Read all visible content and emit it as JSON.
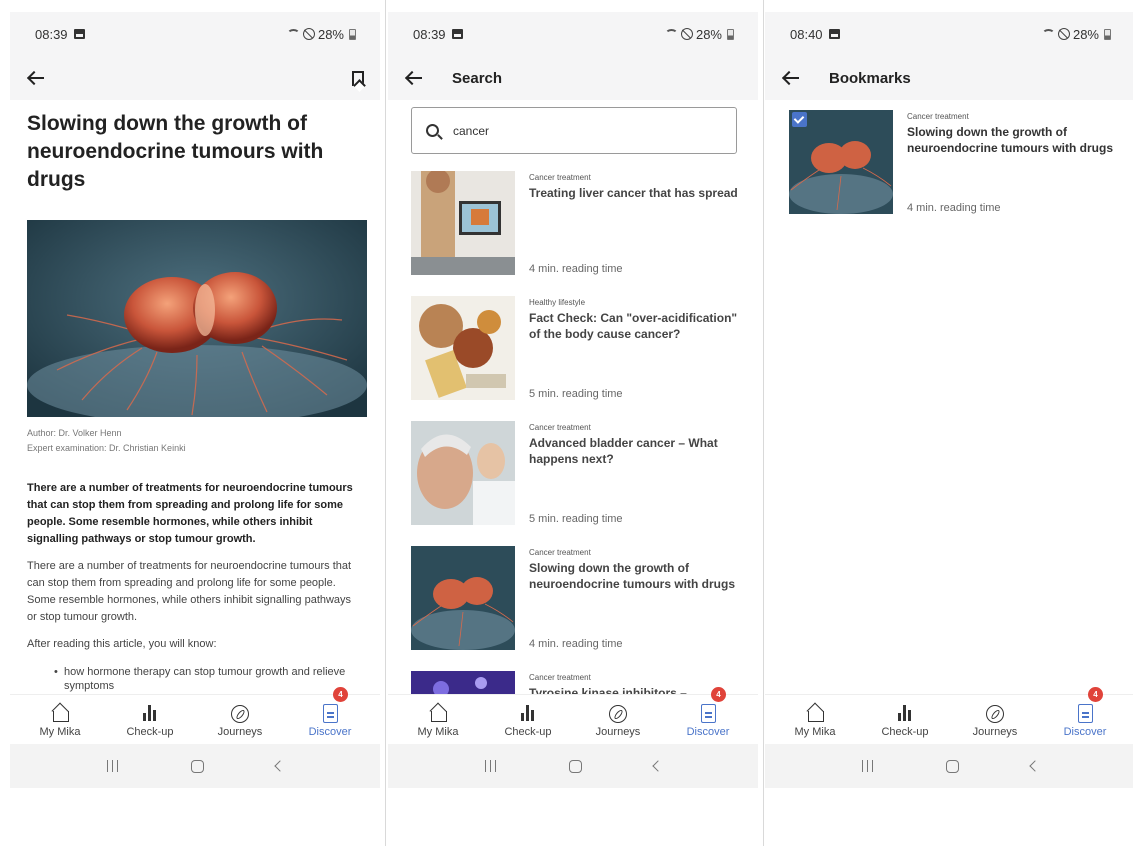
{
  "status_bars": [
    {
      "time": "08:39",
      "battery": "28%"
    },
    {
      "time": "08:39",
      "battery": "28%"
    },
    {
      "time": "08:40",
      "battery": "28%"
    }
  ],
  "article_screen": {
    "title": "Slowing down the growth of neuroendocrine tumours with drugs",
    "author": "Author: Dr. Volker Henn",
    "expert": "Expert examination: Dr. Christian Keinki",
    "lead": "There are a number of treatments for neuroendocrine tumours that can stop them from spreading and prolong life for some people. Some resemble hormones, while others inhibit signalling pathways or stop tumour growth.",
    "paragraph": "There are a number of treatments for neuroendocrine tumours that can stop them from spreading and prolong life for some people. Some resemble hormones, while others inhibit signalling pathways or stop tumour growth.",
    "intro": "After reading this article, you will know:",
    "bullets": [
      "how hormone therapy can stop tumour growth and relieve symptoms"
    ]
  },
  "search_screen": {
    "title": "Search",
    "query": "cancer",
    "results": [
      {
        "category": "Cancer treatment",
        "title": "Treating liver cancer that has spread",
        "time": "4 min. reading time"
      },
      {
        "category": "Healthy lifestyle",
        "title": "Fact Check: Can \"over-acidification\" of the body cause cancer?",
        "time": "5 min. reading time"
      },
      {
        "category": "Cancer treatment",
        "title": "Advanced bladder cancer – What happens next?",
        "time": "5 min. reading time"
      },
      {
        "category": "Cancer treatment",
        "title": "Slowing down the growth of neuroendocrine tumours with drugs",
        "time": "4 min. reading time"
      },
      {
        "category": "Cancer treatment",
        "title": "Tyrosine kinase inhibitors –",
        "time": ""
      }
    ]
  },
  "bookmarks_screen": {
    "title": "Bookmarks",
    "items": [
      {
        "category": "Cancer treatment",
        "title": "Slowing down the growth of neuroendocrine tumours with drugs",
        "time": "4 min. reading time"
      }
    ]
  },
  "bottom_nav": {
    "items": [
      "My Mika",
      "Check-up",
      "Journeys",
      "Discover"
    ],
    "active": "Discover",
    "badge": "4"
  },
  "colors": {
    "accent": "#4a74c9",
    "badge": "#e0433a",
    "bar_bg": "#f5f5f6"
  }
}
